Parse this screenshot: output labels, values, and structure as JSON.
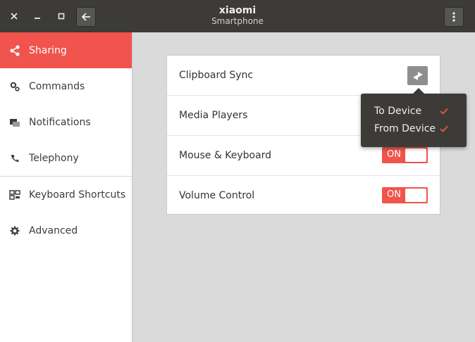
{
  "window": {
    "title": "xiaomi",
    "subtitle": "Smartphone",
    "icons": {
      "close": "close-icon",
      "minimize": "minimize-icon",
      "maximize": "maximize-icon",
      "back": "back-arrow-icon",
      "menu": "kebab-menu-icon"
    }
  },
  "sidebar": {
    "items": [
      {
        "label": "Sharing",
        "icon": "share-icon",
        "active": true
      },
      {
        "label": "Commands",
        "icon": "commands-gears-icon",
        "active": false
      },
      {
        "label": "Notifications",
        "icon": "notifications-icon",
        "active": false
      },
      {
        "label": "Telephony",
        "icon": "phone-icon",
        "active": false
      },
      {
        "label": "Keyboard Shortcuts",
        "icon": "keyboard-shortcuts-icon",
        "active": false
      },
      {
        "label": "Advanced",
        "icon": "gear-icon",
        "active": false
      }
    ]
  },
  "settings": {
    "rows": [
      {
        "label": "Clipboard Sync",
        "control": "sync-button",
        "icon": "sync-arrows-icon"
      },
      {
        "label": "Media Players",
        "control": "toggle"
      },
      {
        "label": "Mouse & Keyboard",
        "control": "toggle",
        "state": "ON"
      },
      {
        "label": "Volume Control",
        "control": "toggle",
        "state": "ON"
      }
    ]
  },
  "popover": {
    "items": [
      {
        "label": "To Device",
        "checked": true
      },
      {
        "label": "From Device",
        "checked": true
      }
    ]
  },
  "colors": {
    "accent": "#f0544c",
    "titlebar": "#3c3b37",
    "background": "#dadada",
    "panel": "#ffffff",
    "popover": "#3c3b37",
    "sync_button": "#8e8e8e"
  }
}
